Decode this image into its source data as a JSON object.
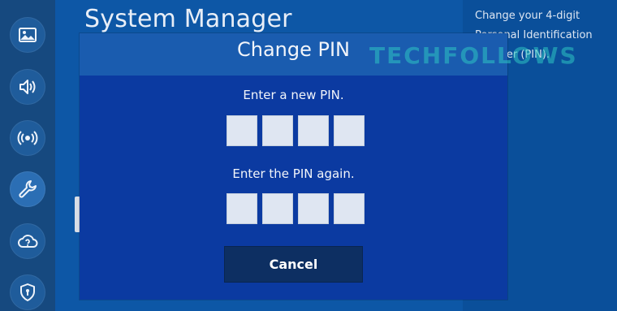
{
  "app": {
    "title": "System Manager"
  },
  "sidebar": {
    "items": [
      {
        "icon": "picture-icon"
      },
      {
        "icon": "sound-icon"
      },
      {
        "icon": "broadcast-icon"
      },
      {
        "icon": "wrench-icon"
      },
      {
        "icon": "cloud-support-icon"
      },
      {
        "icon": "shield-icon"
      }
    ],
    "active_index": 3
  },
  "help": {
    "text": "Change your 4-digit Personal Identification Number (PIN)."
  },
  "dialog": {
    "title": "Change PIN",
    "prompt_new": "Enter a new PIN.",
    "prompt_again": "Enter the PIN again.",
    "cancel_label": "Cancel",
    "new_pin_digits": 4,
    "confirm_pin_digits": 4
  },
  "watermark": {
    "text": "TECHFOLLOWS"
  },
  "colors": {
    "background": "#0d57a6",
    "dialog": "#0b3aa1",
    "dialog_header": "#1a5caf",
    "button": "#0d2f62",
    "watermark": "#2ec4c2"
  }
}
